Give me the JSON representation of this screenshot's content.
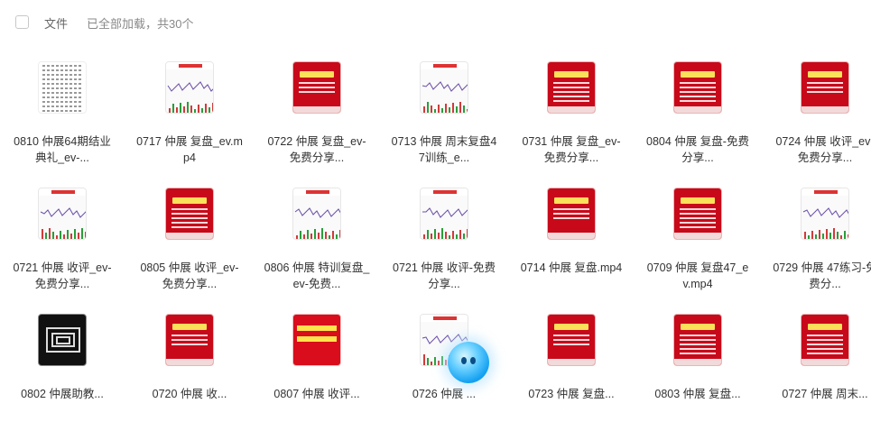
{
  "header": {
    "column_label": "文件",
    "load_status": "已全部加载，共30个"
  },
  "files": [
    {
      "name": "0810 仲展64期结业典礼_ev-...",
      "thumb": "text"
    },
    {
      "name": "0717 仲展 复盘_ev.mp4",
      "thumb": "chart"
    },
    {
      "name": "0722 仲展 复盘_ev-免费分享...",
      "thumb": "red"
    },
    {
      "name": "0713 仲展 周末复盘47训练_e...",
      "thumb": "chart"
    },
    {
      "name": "0731 仲展 复盘_ev-免费分享...",
      "thumb": "red-dense"
    },
    {
      "name": "0804 仲展 复盘-免费分享...",
      "thumb": "red-dense"
    },
    {
      "name": "0724 仲展 收评_ev-免费分享...",
      "thumb": "red"
    },
    {
      "name": "0721 仲展 收评_ev-免费分享...",
      "thumb": "chart"
    },
    {
      "name": "0805 仲展 收评_ev-免费分享...",
      "thumb": "red-dense"
    },
    {
      "name": "0806 仲展 特训复盘_ev-免费...",
      "thumb": "chart"
    },
    {
      "name": "0721 仲展 收评-免费分享...",
      "thumb": "chart"
    },
    {
      "name": "0714 仲展 复盘.mp4",
      "thumb": "red"
    },
    {
      "name": "0709 仲展 复盘47_ev.mp4",
      "thumb": "red-dense"
    },
    {
      "name": "0729 仲展 47练习-免费分...",
      "thumb": "chart"
    },
    {
      "name": "0802 仲展助教...",
      "thumb": "black"
    },
    {
      "name": "0720 仲展 收...",
      "thumb": "red"
    },
    {
      "name": "0807 仲展 收评...",
      "thumb": "yellow"
    },
    {
      "name": "0726 仲展 ...",
      "thumb": "chart"
    },
    {
      "name": "0723 仲展 复盘...",
      "thumb": "red"
    },
    {
      "name": "0803 仲展 复盘...",
      "thumb": "red-dense"
    },
    {
      "name": "0727 仲展 周末...",
      "thumb": "red-dense"
    }
  ],
  "assistant": {
    "icon": "assistant-mascot-icon"
  }
}
